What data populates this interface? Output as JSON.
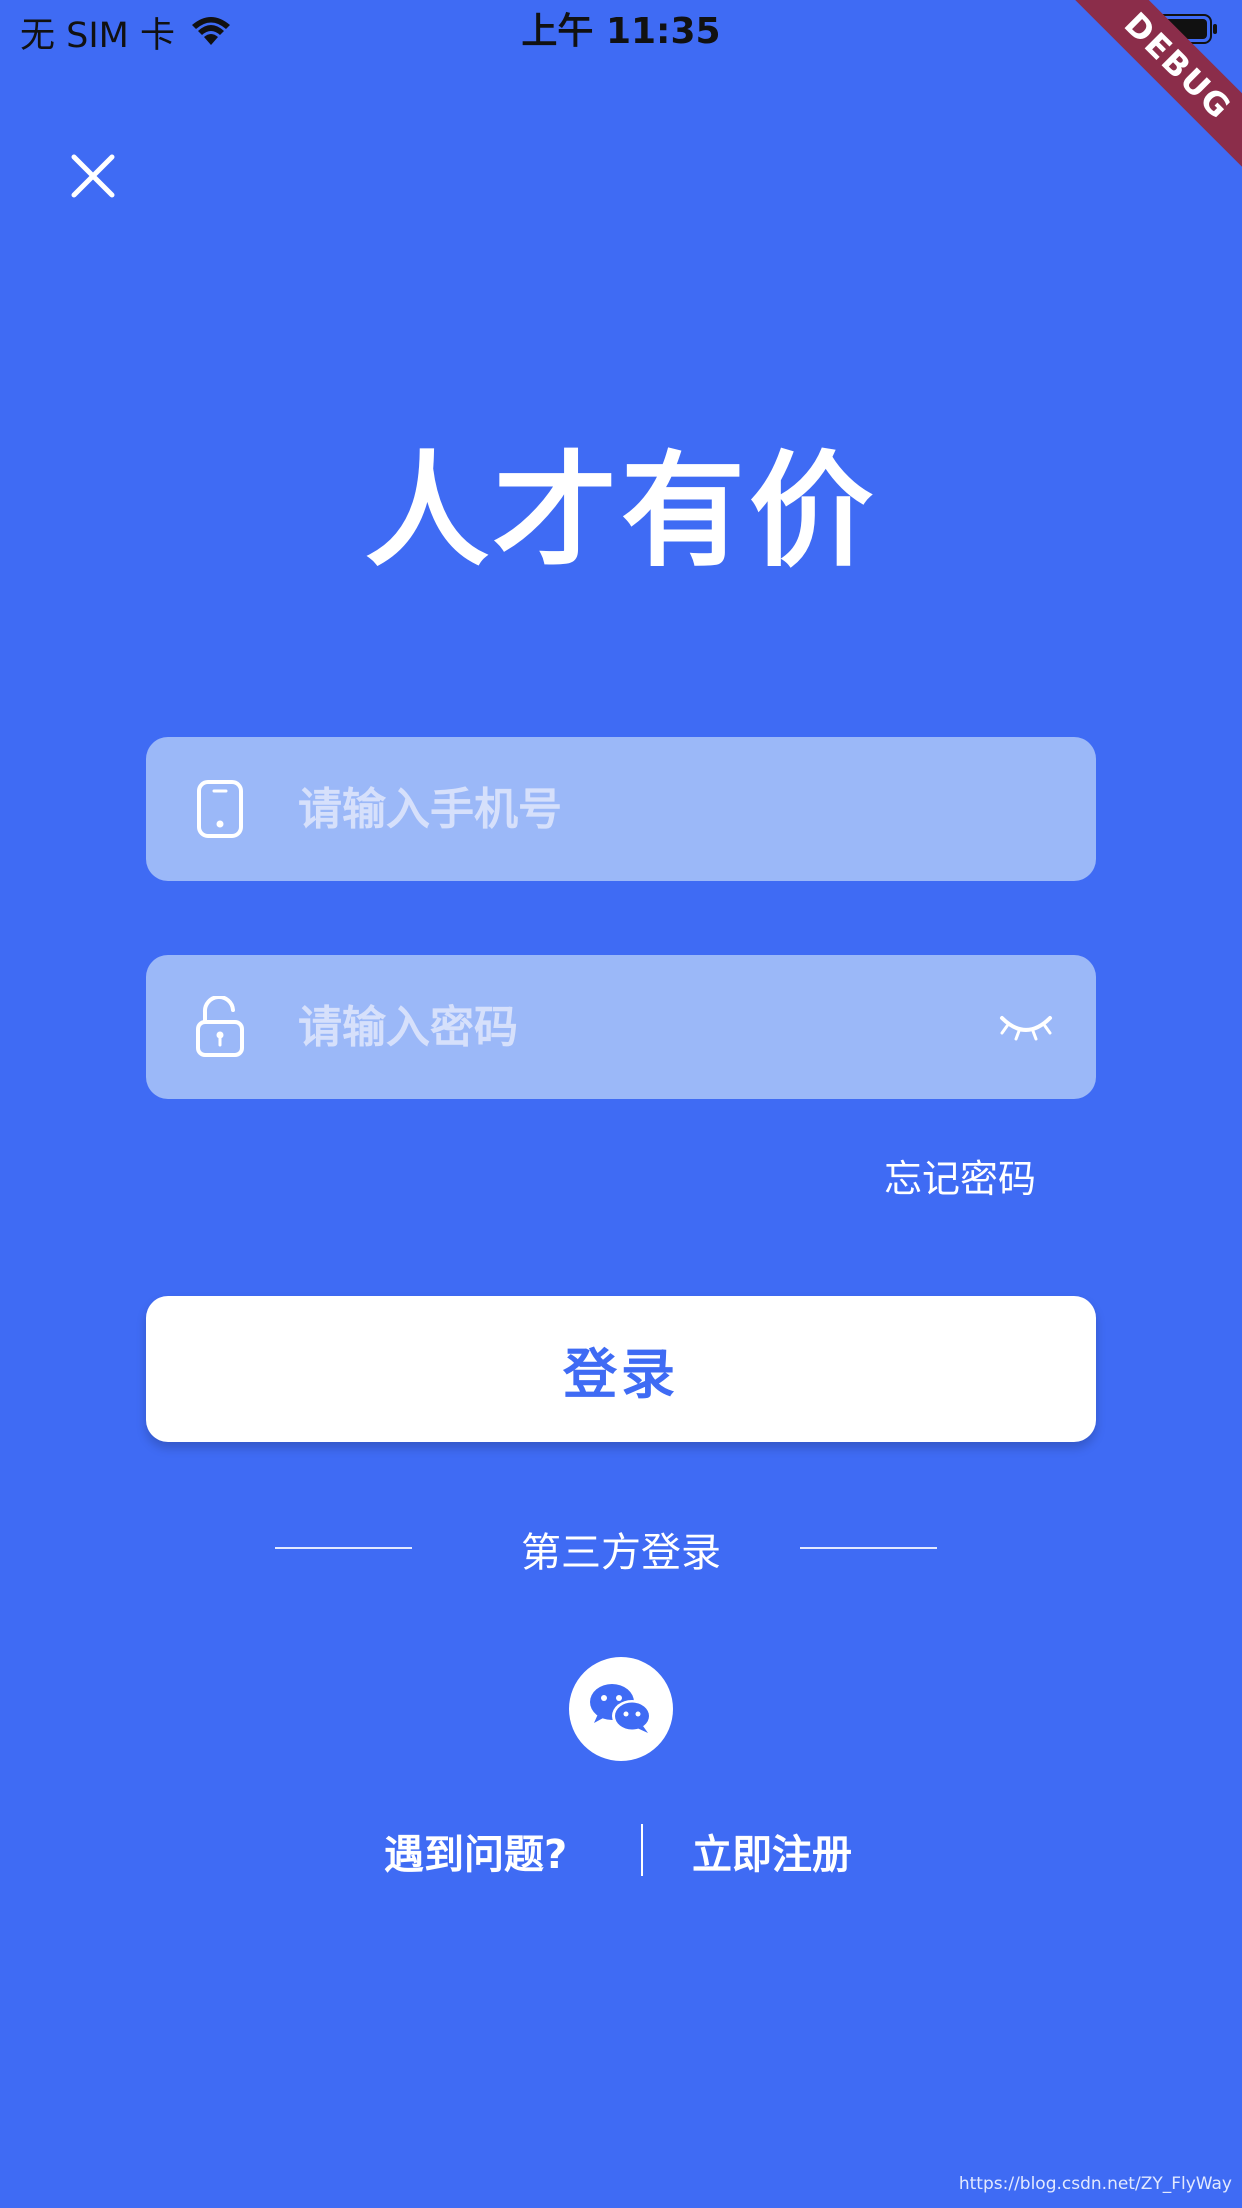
{
  "status_bar": {
    "carrier": "无 SIM 卡",
    "time": "上午 11:35"
  },
  "debug_banner": "DEBUG",
  "title": "人才有价",
  "phone_field": {
    "placeholder": "请输入手机号",
    "value": ""
  },
  "password_field": {
    "placeholder": "请输入密码",
    "value": ""
  },
  "forgot_password": "忘记密码",
  "login_button": "登录",
  "third_party_label": "第三方登录",
  "trouble_link": "遇到问题?",
  "register_link": "立即注册",
  "watermark": "https://blog.csdn.net/ZY_FlyWay",
  "colors": {
    "background": "#3f6bf4",
    "field_bg": "#9bb8f8",
    "button_bg": "#ffffff",
    "accent": "#3f6bf4",
    "debug_ribbon": "#8b2d4a"
  },
  "icons": {
    "close": "close-icon",
    "phone": "phone-icon",
    "lock": "unlock-icon",
    "eye": "eye-closed-icon",
    "wechat": "wechat-icon",
    "wifi": "wifi-icon",
    "battery": "battery-icon"
  }
}
